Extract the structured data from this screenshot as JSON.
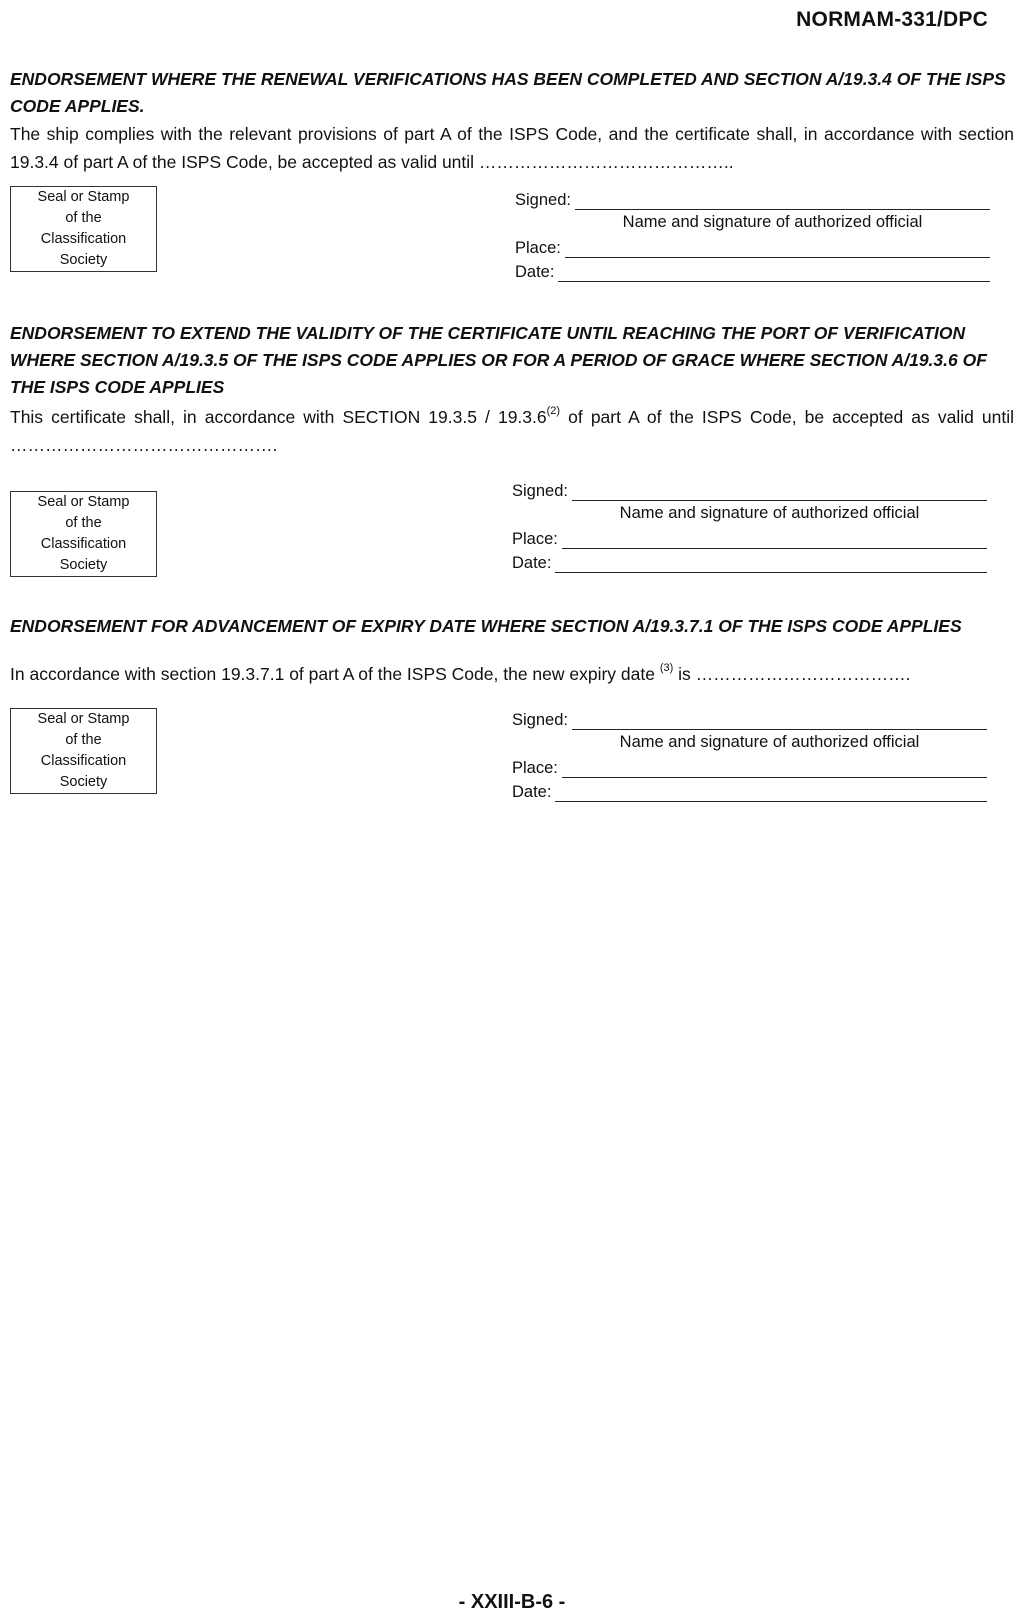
{
  "header": {
    "doc_code": "NORMAM-331/DPC"
  },
  "sections": [
    {
      "heading": "ENDORSEMENT WHERE THE RENEWAL VERIFICATIONS HAS BEEN COMPLETED AND SECTION A/19.3.4 OF THE ISPS CODE APPLIES.",
      "body": "The ship complies with the relevant provisions of part A of the ISPS Code, and the certificate shall, in accordance with section 19.3.4 of part A of the ISPS Code, be accepted as valid until ……………………………………..",
      "stamp": [
        "Seal or Stamp",
        "of the",
        "Classification",
        "Society"
      ],
      "signed_label": "Signed:",
      "caption": "Name and signature of authorized official",
      "place_label": "Place:",
      "date_label": "Date:"
    },
    {
      "heading": "ENDORSEMENT TO EXTEND THE VALIDITY OF THE CERTIFICATE UNTIL REACHING THE PORT OF VERIFICATION WHERE SECTION A/19.3.5 OF THE ISPS CODE APPLIES OR FOR A PERIOD OF GRACE WHERE SECTION A/19.3.6 OF THE ISPS CODE APPLIES",
      "body_pre": "This certificate shall, in accordance with SECTION 19.3.5 / 19.3.6",
      "body_sup": "(2)",
      "body_post": " of part A of the ISPS Code, be accepted as valid until ……………………………………….",
      "stamp": [
        "Seal or Stamp",
        "of the",
        "Classification",
        "Society"
      ],
      "signed_label": "Signed:",
      "caption": "Name and signature of authorized official",
      "place_label": "Place:",
      "date_label": "Date:"
    },
    {
      "heading": "ENDORSEMENT FOR ADVANCEMENT OF EXPIRY DATE WHERE SECTION A/19.3.7.1 OF THE ISPS CODE APPLIES",
      "body_pre": "In accordance with section 19.3.7.1 of part A of the ISPS Code, the new expiry date ",
      "body_sup": "(3)",
      "body_post": " is ……………………………….",
      "stamp": [
        "Seal or Stamp",
        "of the",
        "Classification",
        "Society"
      ],
      "signed_label": "Signed:",
      "caption": "Name and signature of authorized official",
      "place_label": "Place:",
      "date_label": "Date:"
    }
  ],
  "footer": {
    "page_number": "- XXIII-B-6 -"
  }
}
